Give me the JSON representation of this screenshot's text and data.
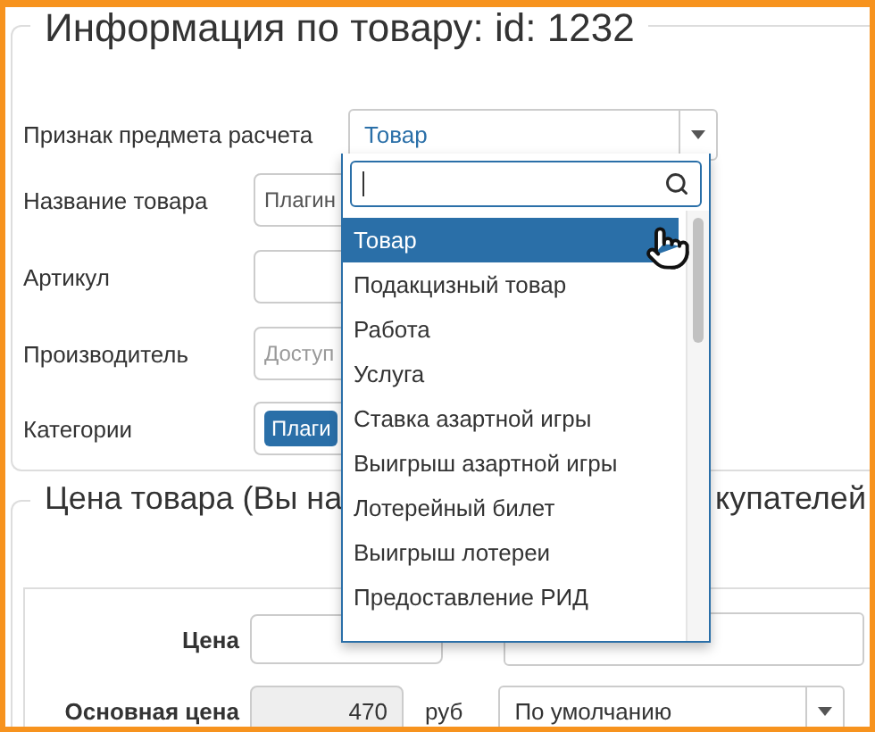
{
  "product_info": {
    "legend": "Информация по товару: id: 1232",
    "fields": [
      {
        "kind": "select",
        "label": "Признак предмета расчета",
        "value": "Товар"
      },
      {
        "kind": "text",
        "label": "Название товара",
        "value": "Плагин"
      },
      {
        "kind": "text",
        "label": "Артикул"
      },
      {
        "kind": "placeholder",
        "label": "Производитель",
        "placeholder": "Доступ"
      },
      {
        "kind": "tag",
        "label": "Категории",
        "value": "Плаги"
      }
    ]
  },
  "dropdown": {
    "options": [
      {
        "label": "Товар",
        "selected": true
      },
      {
        "label": "Подакцизный товар",
        "selected": false
      },
      {
        "label": "Работа",
        "selected": false
      },
      {
        "label": "Услуга",
        "selected": false
      },
      {
        "label": "Ставка азартной игры",
        "selected": false
      },
      {
        "label": "Выигрыш азартной игры",
        "selected": false
      },
      {
        "label": "Лотерейный билет",
        "selected": false
      },
      {
        "label": "Выигрыш лотереи",
        "selected": false
      },
      {
        "label": "Предоставление РИД",
        "selected": false
      }
    ]
  },
  "price": {
    "legend_start": "Цена товара (Вы на",
    "legend_end": "купателей",
    "price_label": "Цена",
    "base_label": "Основная цена",
    "base_value": "470",
    "base_unit": "руб",
    "base_select": "По умолчанию"
  }
}
